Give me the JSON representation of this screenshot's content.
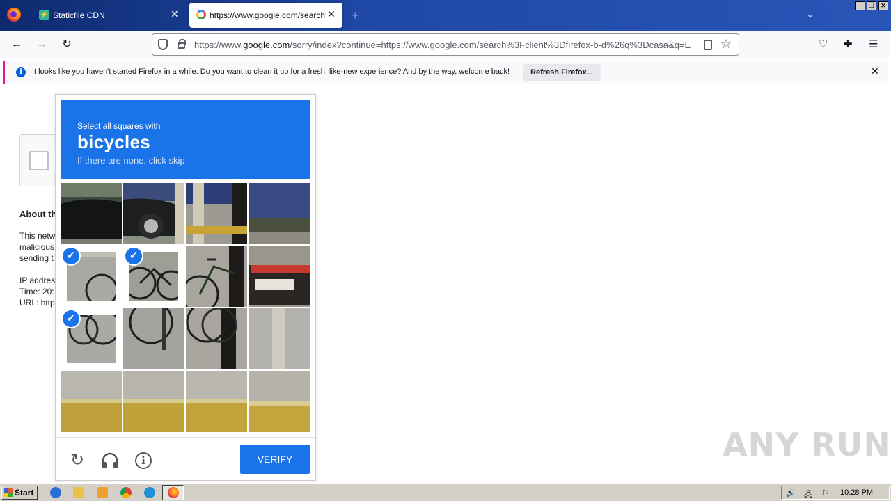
{
  "browser": {
    "tabs": [
      {
        "title": "Staticfile CDN",
        "icon": "staticfile-icon",
        "active": false
      },
      {
        "title": "https://www.google.com/search?c",
        "icon": "google-icon",
        "active": true
      }
    ],
    "url_prefix": "https://www.",
    "url_domain": "google.com",
    "url_rest": "/sorry/index?continue=https://www.google.com/search%3Fclient%3Dfirefox-b-d%26q%3Dcasa&q=E"
  },
  "notification": {
    "message": "It looks like you haven't started Firefox in a while. Do you want to clean it up for a fresh, like-new experience? And by the way, welcome back!",
    "button": "Refresh Firefox..."
  },
  "background_page": {
    "heading": "About th",
    "lines": [
      "This netw",
      "malicious",
      "sending t"
    ],
    "info": [
      "IP addres",
      "Time: 20:",
      "URL: http"
    ]
  },
  "captcha": {
    "instruction": "Select all squares with",
    "target": "bicycles",
    "hint": "If there are none, click skip",
    "verify_label": "VERIFY",
    "selected_tiles": [
      4,
      5,
      8
    ],
    "icons": [
      "reload-icon",
      "headphones-icon",
      "info-icon"
    ]
  },
  "watermark": "ANY RUN",
  "taskbar": {
    "start_label": "Start",
    "clock": "10:28 PM"
  },
  "colors": {
    "captcha_blue": "#1a73e8",
    "tab_strip": "#1f47a6",
    "notification_accent": "#e31587"
  }
}
